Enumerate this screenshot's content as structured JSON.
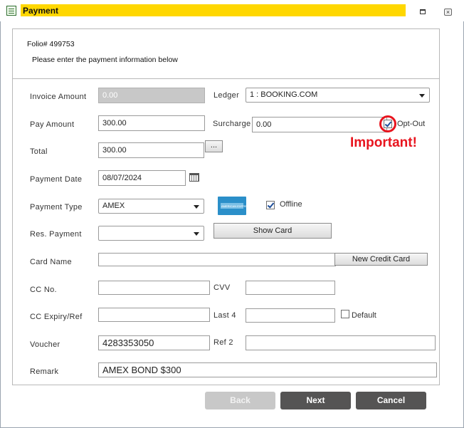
{
  "window": {
    "title": "Payment"
  },
  "header": {
    "folio": "Folio# 499753",
    "instructions": "Please enter the payment information below"
  },
  "form": {
    "invoice_amount": {
      "label": "Invoice Amount",
      "value": "0.00"
    },
    "ledger": {
      "label": "Ledger",
      "value": "1 : BOOKING.COM"
    },
    "pay_amount": {
      "label": "Pay Amount",
      "value": "300.00"
    },
    "surcharge": {
      "label": "Surcharge",
      "value": "0.00"
    },
    "opt_out": {
      "label": "Opt-Out",
      "checked": true
    },
    "important_note": "Important!",
    "total": {
      "label": "Total",
      "value": "300.00",
      "button_label": "..."
    },
    "payment_date": {
      "label": "Payment Date",
      "value": "08/07/2024"
    },
    "payment_type": {
      "label": "Payment Type",
      "value": "AMEX"
    },
    "offline": {
      "label": "Offline",
      "checked": true
    },
    "card_logo_text": "AMERICAN EXPRESS",
    "res_payment": {
      "label": "Res. Payment",
      "value": ""
    },
    "show_card_button": "Show Card",
    "card_name": {
      "label": "Card Name",
      "value": ""
    },
    "new_credit_card_button": "New Credit Card",
    "cc_no": {
      "label": "CC No.",
      "value": ""
    },
    "cvv": {
      "label": "CVV",
      "value": ""
    },
    "cc_expiry": {
      "label": "CC Expiry/Ref",
      "value": ""
    },
    "last4": {
      "label": "Last 4",
      "value": ""
    },
    "default": {
      "label": "Default",
      "checked": false
    },
    "voucher": {
      "label": "Voucher",
      "value": "4283353050"
    },
    "ref2": {
      "label": "Ref 2",
      "value": ""
    },
    "remark": {
      "label": "Remark",
      "value": "AMEX BOND $300"
    }
  },
  "footer": {
    "back": "Back",
    "next": "Next",
    "cancel": "Cancel"
  },
  "colors": {
    "title_highlight": "#FFD700",
    "important_red": "#E8141E",
    "dark_button": "#555454",
    "disabled_button": "#C8C8C8"
  }
}
